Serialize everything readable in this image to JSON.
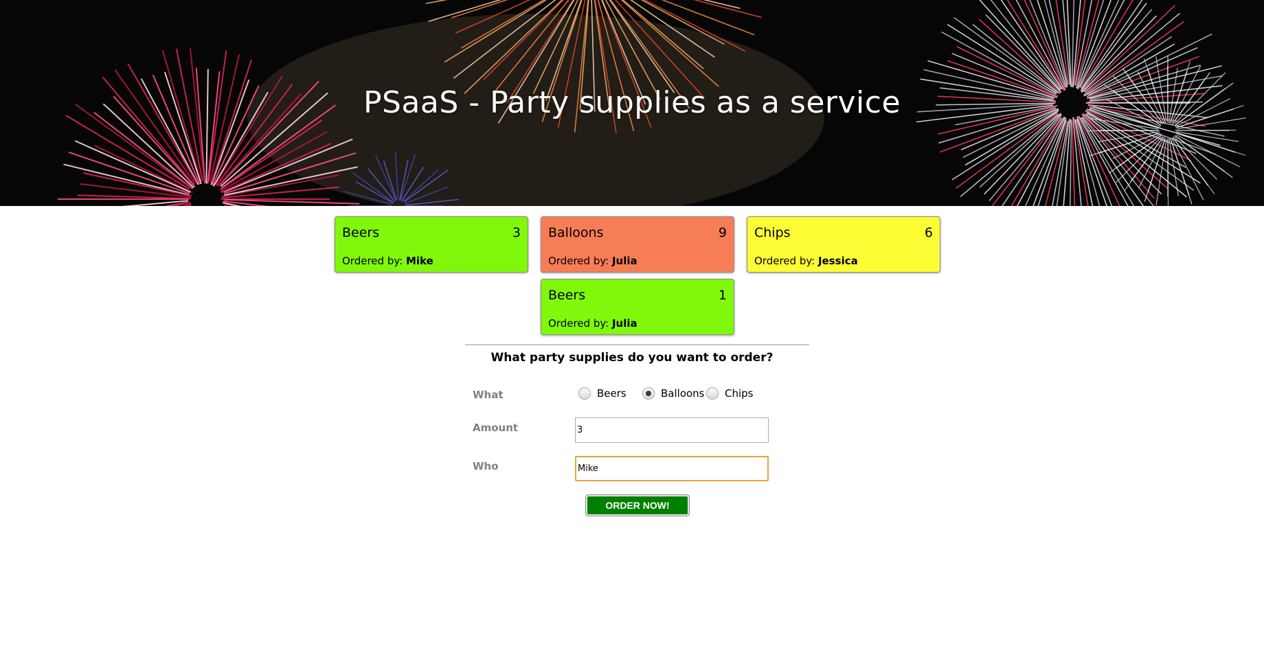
{
  "header": {
    "title": "PSaaS - Party supplies as a service"
  },
  "orders": [
    {
      "item": "Beers",
      "count": "3",
      "ordered_by_label": "Ordered by:",
      "ordered_by": "Mike",
      "color": "#80f80c"
    },
    {
      "item": "Balloons",
      "count": "9",
      "ordered_by_label": "Ordered by:",
      "ordered_by": "Julia",
      "color": "#f77d57"
    },
    {
      "item": "Chips",
      "count": "6",
      "ordered_by_label": "Ordered by:",
      "ordered_by": "Jessica",
      "color": "#fdfd35"
    },
    {
      "item": "Beers",
      "count": "1",
      "ordered_by_label": "Ordered by:",
      "ordered_by": "Julia",
      "color": "#80f80c"
    }
  ],
  "form": {
    "question": "What party supplies do you want to order?",
    "what_label": "What",
    "options": [
      "Beers",
      "Balloons",
      "Chips"
    ],
    "selected_option": "Balloons",
    "amount_label": "Amount",
    "amount_value": "3",
    "who_label": "Who",
    "who_value": "Mike",
    "submit_label": "ORDER NOW!",
    "submit_color": "#008000"
  }
}
